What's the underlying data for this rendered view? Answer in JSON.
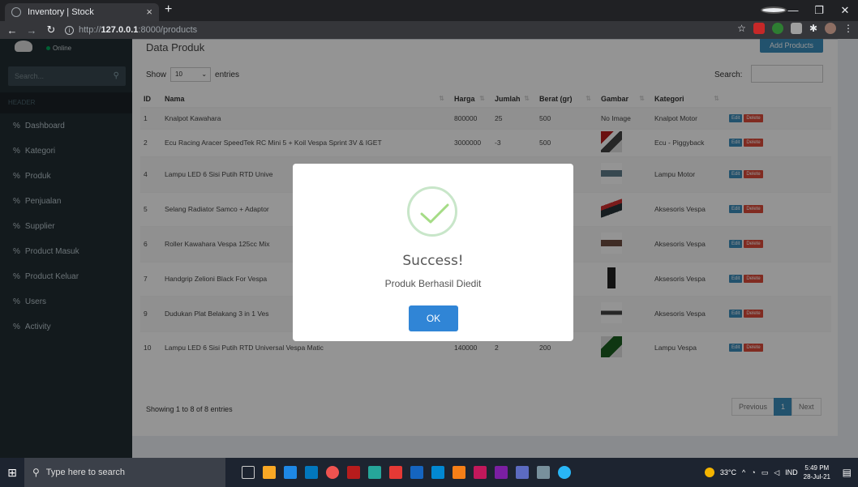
{
  "browser": {
    "tab_title": "Inventory | Stock",
    "tab_close": "×",
    "new_tab": "+",
    "url_prefix": "http://",
    "url_host": "127.0.0.1",
    "url_path": ":8000/products"
  },
  "sidebar": {
    "status": "Online",
    "search_placeholder": "Search...",
    "header": "HEADER",
    "items": [
      {
        "label": "Dashboard"
      },
      {
        "label": "Kategori"
      },
      {
        "label": "Produk"
      },
      {
        "label": "Penjualan"
      },
      {
        "label": "Supplier"
      },
      {
        "label": "Product Masuk"
      },
      {
        "label": "Product Keluar"
      },
      {
        "label": "Users"
      },
      {
        "label": "Activity"
      }
    ]
  },
  "main": {
    "title": "Data Produk",
    "add_button": "Add Products",
    "show_label": "Show",
    "entries_value": "10",
    "entries_label": "entries",
    "search_label": "Search:",
    "columns": [
      "ID",
      "Nama",
      "Harga",
      "Jumlah",
      "Berat (gr)",
      "Gambar",
      "Kategori",
      ""
    ],
    "rows": [
      {
        "id": "1",
        "nama": "Knalpot Kawahara",
        "harga": "800000",
        "jumlah": "25",
        "berat": "500",
        "gambar": "No Image",
        "kategori": "Knalpot Motor"
      },
      {
        "id": "2",
        "nama": "Ecu Racing Aracer SpeedTek RC Mini 5 + Koil Vespa Sprint 3V & IGET",
        "harga": "3000000",
        "jumlah": "-3",
        "berat": "500",
        "gambar": "",
        "kategori": "Ecu - Piggyback"
      },
      {
        "id": "4",
        "nama": "Lampu LED 6 Sisi Putih RTD Unive",
        "harga": "",
        "jumlah": "",
        "berat": "00",
        "gambar": "",
        "kategori": "Lampu Motor"
      },
      {
        "id": "5",
        "nama": "Selang Radiator Samco + Adaptor",
        "harga": "",
        "jumlah": "",
        "berat": "00",
        "gambar": "",
        "kategori": "Aksesoris Vespa"
      },
      {
        "id": "6",
        "nama": "Roller Kawahara Vespa 125cc Mix",
        "harga": "",
        "jumlah": "",
        "berat": "00",
        "gambar": "",
        "kategori": "Aksesoris Vespa"
      },
      {
        "id": "7",
        "nama": "Handgrip Zelioni Black For Vespa",
        "harga": "",
        "jumlah": "",
        "berat": "00",
        "gambar": "",
        "kategori": "Aksesoris Vespa"
      },
      {
        "id": "9",
        "nama": "Dudukan Plat Belakang 3 in 1 Ves",
        "harga": "",
        "jumlah": "",
        "berat": "00",
        "gambar": "",
        "kategori": "Aksesoris Vespa"
      },
      {
        "id": "10",
        "nama": "Lampu LED 6 Sisi Putih RTD Universal Vespa Matic",
        "harga": "140000",
        "jumlah": "2",
        "berat": "200",
        "gambar": "",
        "kategori": "Lampu Vespa"
      }
    ],
    "edit_label": "Edit",
    "delete_label": "Delete",
    "showing_text": "Showing 1 to 8 of 8 entries",
    "pager": {
      "previous": "Previous",
      "current": "1",
      "next": "Next"
    }
  },
  "modal": {
    "title": "Success!",
    "message": "Produk Berhasil Diedit",
    "ok_label": "OK"
  },
  "taskbar": {
    "search_placeholder": "Type here to search",
    "temperature": "33°C",
    "language": "IND",
    "time": "5:49 PM",
    "date": "28-Jul-21"
  },
  "colors": {
    "sidebar_bg": "#222d32",
    "primary": "#3c8dbc",
    "danger": "#dd4b39",
    "success_check": "#a5dc86",
    "ok_button": "#3085d6"
  }
}
